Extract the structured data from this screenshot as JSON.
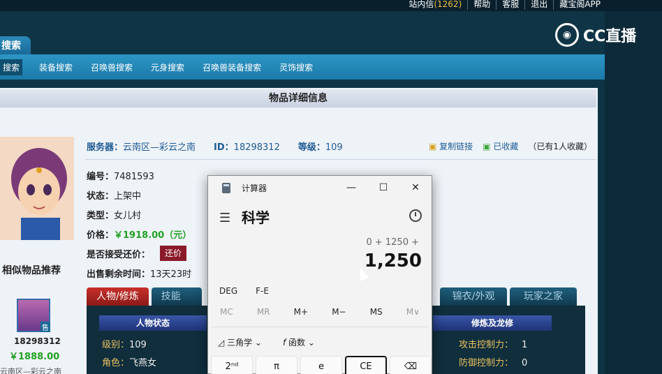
{
  "topbar": {
    "links": [
      "站内信",
      "帮助",
      "客服",
      "退出",
      "藏宝阁APP"
    ],
    "msg_count": "(1262)"
  },
  "watermark": {
    "text": "CC直播"
  },
  "search_tab": "搜索",
  "nav": {
    "items": [
      "搜索",
      "装备搜索",
      "召唤兽搜索",
      "元身搜索",
      "召唤兽装备搜索",
      "灵饰搜索"
    ]
  },
  "detail": {
    "header": "物品详细信息",
    "server_label": "服务器：",
    "server_value": "云南区—彩云之南",
    "id_label": "ID：",
    "id_value": "18298312",
    "level_label": "等级：",
    "level_value": "109",
    "copy_link": "复制链接",
    "favorited": "已收藏",
    "favorite_note": "（已有1人收藏）",
    "fields": [
      {
        "k": "编号：",
        "v": "7481593"
      },
      {
        "k": "状态：",
        "v": "上架中"
      },
      {
        "k": "类型：",
        "v": "女儿村"
      },
      {
        "k": "价格：",
        "v": "￥1918.00（元）"
      },
      {
        "k": "是否接受还价：",
        "v": ""
      },
      {
        "k": "出售剩余时间：",
        "v": "13天23时"
      }
    ],
    "bargain_btn": "还价"
  },
  "similar": {
    "title": "相似物品推荐",
    "badge": "售",
    "id": "18298312",
    "price": "￥1888.00",
    "server": "云南区—彩云之南"
  },
  "tabs_left": [
    "人物/修炼",
    "技能"
  ],
  "tabs_right": [
    "锦衣/外观",
    "玩家之家"
  ],
  "panel": {
    "bar_left": "人物状态",
    "bar_right": "修炼及龙修",
    "stats_left": [
      {
        "k": "级别：",
        "v": "109"
      },
      {
        "k": "角色：",
        "v": "飞燕女"
      }
    ],
    "stats_right": [
      {
        "k": "攻击控制力：",
        "v": "1"
      },
      {
        "k": "防御控制力：",
        "v": "0"
      }
    ]
  },
  "calculator": {
    "title": "计算器",
    "mode": "科学",
    "expression": "0 + 1250 +",
    "result": "1,250",
    "angle_row": [
      "DEG",
      "F-E"
    ],
    "memory_row": [
      "MC",
      "MR",
      "M+",
      "M−",
      "MS",
      "M∨"
    ],
    "func_row": [
      "三角学",
      "函数"
    ],
    "keys": [
      "2ⁿᵈ",
      "π",
      "e",
      "CE",
      "⌫"
    ]
  }
}
